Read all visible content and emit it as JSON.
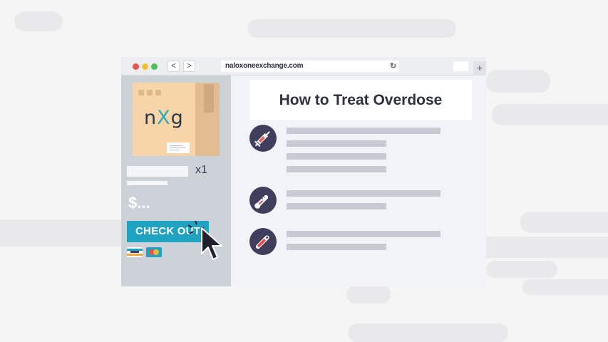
{
  "browser": {
    "url": "naloxoneexchange.com",
    "back_label": "<",
    "forward_label": ">",
    "reload_icon": "↻",
    "new_tab_label": "+"
  },
  "cart": {
    "product_logo_left": "n",
    "product_logo_mid": "X",
    "product_logo_right": "g",
    "quantity": "x1",
    "price": "$...",
    "checkout_label": "CHECK OUT"
  },
  "content": {
    "heading": "How to Treat Overdose",
    "icons": [
      "syringe-icon",
      "thermometer-icon",
      "ampule-icon"
    ]
  },
  "colors": {
    "checkout": "#20a2c1",
    "icon_circle": "#3f3e5c",
    "sidebar": "#cdd1d8",
    "content_bg": "#f2f3f9"
  }
}
